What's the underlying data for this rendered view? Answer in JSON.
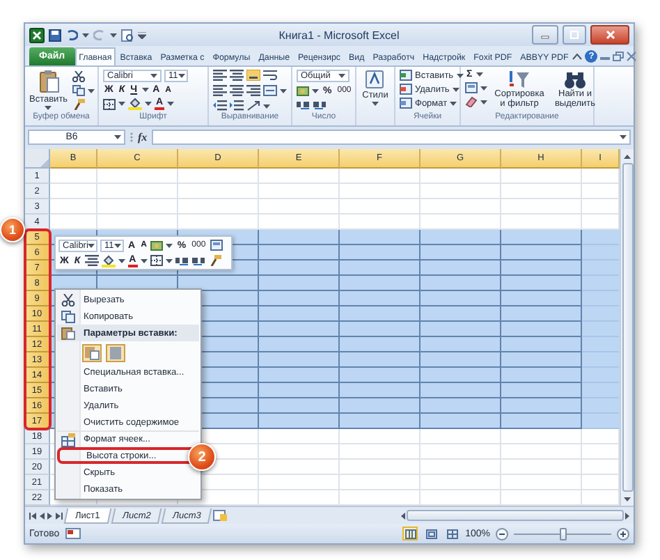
{
  "window": {
    "title": "Книга1 - Microsoft Excel"
  },
  "ribbon_tabs": [
    {
      "kind": "file",
      "label": "Файл",
      "selected": false
    },
    {
      "kind": "tab",
      "label": "Главная",
      "selected": true
    },
    {
      "kind": "tab",
      "label": "Вставка",
      "selected": false
    },
    {
      "kind": "tab",
      "label": "Разметка с",
      "selected": false
    },
    {
      "kind": "tab",
      "label": "Формулы",
      "selected": false
    },
    {
      "kind": "tab",
      "label": "Данные",
      "selected": false
    },
    {
      "kind": "tab",
      "label": "Рецензирс",
      "selected": false
    },
    {
      "kind": "tab",
      "label": "Вид",
      "selected": false
    },
    {
      "kind": "tab",
      "label": "Разработч",
      "selected": false
    },
    {
      "kind": "tab",
      "label": "Надстройк",
      "selected": false
    },
    {
      "kind": "tab",
      "label": "Foxit PDF",
      "selected": false
    },
    {
      "kind": "tab",
      "label": "ABBYY PDF",
      "selected": false
    }
  ],
  "ribbon_help": "?",
  "ribbon_groups": [
    {
      "kind": "clipboard",
      "label": "Буфер обмена",
      "paste": "Вставить"
    },
    {
      "kind": "font",
      "label": "Шрифт",
      "font": "Calibri",
      "size": "11",
      "bold": "Ж",
      "italic": "К",
      "underline": "Ч",
      "grow_font": "A",
      "shrink_font": "A",
      "font_color": "A"
    },
    {
      "kind": "alignment",
      "label": "Выравнивание"
    },
    {
      "kind": "number",
      "label": "Число",
      "format": "Общий",
      "percent": "%",
      "thousands": "000"
    },
    {
      "kind": "styles",
      "button": "Стили"
    },
    {
      "kind": "cells",
      "label": "Ячейки",
      "buttons": [
        "Вставить",
        "Удалить",
        "Формат"
      ]
    },
    {
      "kind": "editing",
      "label": "Редактирование",
      "sum": "Σ",
      "sort": "Сортировка и фильтр",
      "find": "Найти и выделить"
    }
  ],
  "formula_bar": {
    "name_box": "B6",
    "fx": "fx"
  },
  "columns": [
    {
      "label": "B",
      "selected": true
    },
    {
      "label": "C",
      "selected": true
    },
    {
      "label": "D",
      "selected": true
    },
    {
      "label": "E",
      "selected": true
    },
    {
      "label": "F",
      "selected": true
    },
    {
      "label": "G",
      "selected": true
    },
    {
      "label": "H",
      "selected": true
    },
    {
      "label": "I",
      "selected": true
    }
  ],
  "rows": [
    {
      "label": "1",
      "selected": false
    },
    {
      "label": "2",
      "selected": false
    },
    {
      "label": "3",
      "selected": false
    },
    {
      "label": "4",
      "selected": false
    },
    {
      "label": "5",
      "selected": true
    },
    {
      "label": "6",
      "selected": true
    },
    {
      "label": "7",
      "selected": true
    },
    {
      "label": "8",
      "selected": true
    },
    {
      "label": "9",
      "selected": true
    },
    {
      "label": "10",
      "selected": true
    },
    {
      "label": "11",
      "selected": true
    },
    {
      "label": "12",
      "selected": true
    },
    {
      "label": "13",
      "selected": true
    },
    {
      "label": "14",
      "selected": true
    },
    {
      "label": "15",
      "selected": true
    },
    {
      "label": "16",
      "selected": true
    },
    {
      "label": "17",
      "selected": true
    },
    {
      "label": "18",
      "selected": false
    },
    {
      "label": "19",
      "selected": false
    },
    {
      "label": "20",
      "selected": false
    },
    {
      "label": "21",
      "selected": false
    },
    {
      "label": "22",
      "selected": false
    }
  ],
  "row_callout": "1",
  "mini_toolbar": {
    "font": "Calibri",
    "size": "11",
    "grow_font": "A",
    "shrink_font": "A",
    "percent": "%",
    "thousands": "000",
    "bold": "Ж",
    "italic": "К",
    "font_color": "A"
  },
  "context_menu": [
    {
      "kind": "cut",
      "label": "Вырезать"
    },
    {
      "kind": "copy",
      "label": "Копировать"
    },
    {
      "kind": "paste_header",
      "label": "Параметры вставки:"
    },
    {
      "kind": "paste_options"
    },
    {
      "kind": "item",
      "label": "Специальная вставка..."
    },
    {
      "kind": "item",
      "label": "Вставить"
    },
    {
      "kind": "item",
      "label": "Удалить"
    },
    {
      "kind": "item",
      "label": "Очистить содержимое"
    },
    {
      "kind": "format_cells",
      "label": "Формат ячеек..."
    },
    {
      "kind": "item",
      "label": "Высота строки...",
      "callout": "2"
    },
    {
      "kind": "item",
      "label": "Скрыть"
    },
    {
      "kind": "item",
      "label": "Показать"
    }
  ],
  "sheet_tabs": [
    {
      "label": "Лист1",
      "selected": true
    },
    {
      "label": "Лист2",
      "selected": false
    },
    {
      "label": "Лист3",
      "selected": false
    }
  ],
  "status_bar": {
    "text": "Готово",
    "views": [
      {
        "selected": true
      },
      {
        "selected": false
      },
      {
        "selected": false
      }
    ],
    "zoom": "100%",
    "zoom_slider": {
      "level": 0.5
    }
  }
}
